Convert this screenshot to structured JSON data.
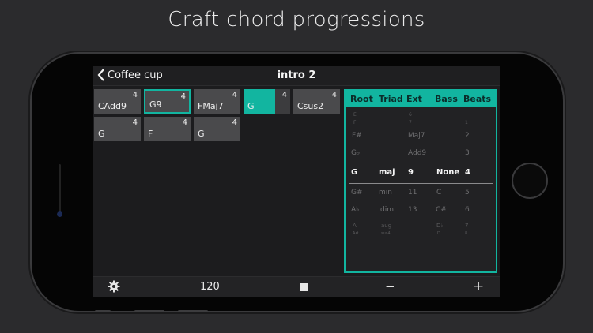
{
  "headline": "Craft chord progressions",
  "nav": {
    "back_label": "Coffee cup",
    "title": "intro 2"
  },
  "chords": [
    {
      "name": "CAdd9",
      "beats": "4"
    },
    {
      "name": "G9",
      "beats": "4",
      "selected": true
    },
    {
      "name": "FMaj7",
      "beats": "4"
    },
    {
      "name": "G",
      "beats": "4",
      "playing": true
    },
    {
      "name": "Csus2",
      "beats": "4"
    },
    {
      "name": "G",
      "beats": "4"
    },
    {
      "name": "F",
      "beats": "4"
    },
    {
      "name": "G",
      "beats": "4"
    }
  ],
  "picker": {
    "headers": [
      "Root",
      "Triad",
      "Ext",
      "Bass",
      "Beats"
    ],
    "rows": [
      [
        "E",
        "",
        "6",
        "",
        ""
      ],
      [
        "F",
        "",
        "7",
        "",
        "1"
      ],
      [
        "F#",
        "",
        "Maj7",
        "",
        "2"
      ],
      [
        "G♭",
        "",
        "Add9",
        "",
        "3"
      ],
      [
        "G",
        "maj",
        "9",
        "None",
        "4"
      ],
      [
        "G#",
        "min",
        "11",
        "C",
        "5"
      ],
      [
        "A♭",
        "dim",
        "13",
        "C#",
        "6"
      ],
      [
        "A",
        "aug",
        "",
        "D♭",
        "7"
      ],
      [
        "A#",
        "sus4",
        "",
        "D",
        "8"
      ]
    ]
  },
  "toolbar": {
    "tempo": "120",
    "minus": "−",
    "plus": "+"
  },
  "colors": {
    "accent": "#12b5a0",
    "tile": "#4a4a4c",
    "screen": "#1c1c1e"
  }
}
